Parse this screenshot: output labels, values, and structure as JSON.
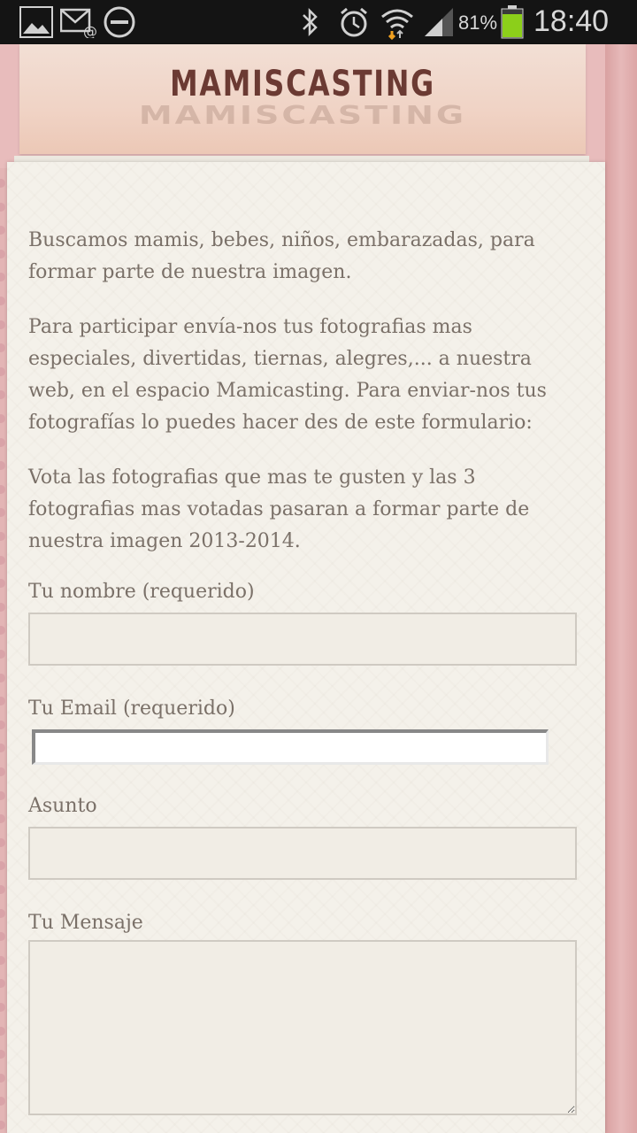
{
  "status_bar": {
    "icons": [
      "gallery-icon",
      "email-icon",
      "do-not-disturb-icon",
      "bluetooth-icon",
      "alarm-icon",
      "wifi-icon",
      "signal-icon",
      "battery-icon"
    ],
    "battery_percent": "81%",
    "time": "18:40"
  },
  "header": {
    "title": "MAMISCASTING"
  },
  "content": {
    "paragraphs": [
      "Buscamos mamis, bebes, niños, embarazadas, para formar parte de nuestra imagen.",
      "Para participar envía-nos tus fotografias mas especiales, divertidas, tiernas, alegres,... a nuestra web, en el espacio Mamicasting. Para enviar-nos tus fotografías lo puedes hacer des de este formulario:",
      "Vota las fotografias que mas te gusten y las 3 fotografias mas votadas pasaran a formar parte de nuestra imagen 2013-2014."
    ]
  },
  "form": {
    "name_label": "Tu nombre (requerido)",
    "name_value": "",
    "email_label": "Tu Email (requerido)",
    "email_value": "",
    "subject_label": "Asunto",
    "subject_value": "",
    "message_label": "Tu Mensaje",
    "message_value": ""
  },
  "colors": {
    "background_pink": "#e3b5b5",
    "title_brown": "#6b3a33",
    "text_gray": "#7a7068",
    "battery_green": "#8ccf1a"
  }
}
